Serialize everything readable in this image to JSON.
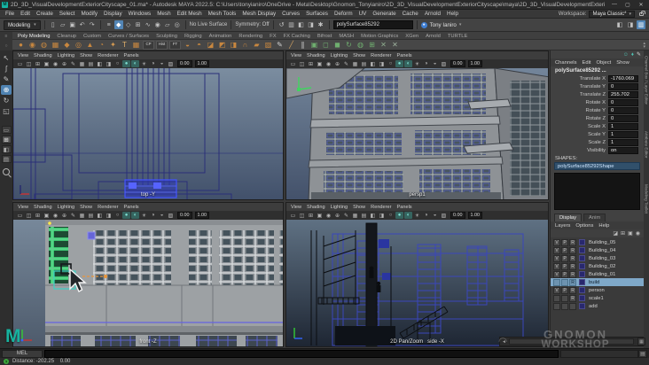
{
  "window": {
    "title": "2D_3D_VisualDevelopmentExteriorCityscape_01.ma* - Autodesk MAYA 2022.5: C:\\Users\\tonyianiro\\OneDrive - Meta\\Desktop\\Gnomon_Tonyianiro\\2D_3D_VisualDevelopmentExteriorCityscape\\maya\\2D_3D_VisualDevelopmentExteriorCityscape_01.ma --- polySurface85292...",
    "logo_letter": "M",
    "minimize": "—",
    "maximize": "▢",
    "close": "✕"
  },
  "menubar": {
    "items": [
      "File",
      "Edit",
      "Create",
      "Select",
      "Modify",
      "Display",
      "Windows",
      "Mesh",
      "Edit Mesh",
      "Mesh Tools",
      "Mesh Display",
      "Curves",
      "Surfaces",
      "Deform",
      "UV",
      "Generate",
      "Cache",
      "Arnold",
      "Help"
    ]
  },
  "workspace": {
    "label": "Workspace:",
    "value": "Maya Classic*"
  },
  "ui": {
    "dropdown_arrow": "▾",
    "scroll_left": "◄",
    "scroll_right": "►",
    "scroll_up": "▴",
    "scroll_down": "▾"
  },
  "statusline": {
    "mode": "Modeling",
    "left_icons": [
      {
        "name": "new-scene-icon",
        "glyph": "▯"
      },
      {
        "name": "open-scene-icon",
        "glyph": "▱"
      },
      {
        "name": "save-scene-icon",
        "glyph": "▣"
      },
      {
        "name": "undo-icon",
        "glyph": "↶"
      },
      {
        "name": "redo-icon",
        "glyph": "↷"
      }
    ],
    "mask_icons": [
      {
        "name": "select-by-hierarchy-icon",
        "glyph": "≡"
      },
      {
        "name": "select-by-object-icon",
        "glyph": "◆",
        "active": true
      },
      {
        "name": "select-by-component-icon",
        "glyph": "◇"
      },
      {
        "name": "snap-to-grid-icon",
        "glyph": "⊞"
      },
      {
        "name": "snap-to-curves-icon",
        "glyph": "∿"
      },
      {
        "name": "snap-to-points-icon",
        "glyph": "◉"
      },
      {
        "name": "snap-to-planes-icon",
        "glyph": "▱"
      },
      {
        "name": "make-live-icon",
        "glyph": "◎"
      }
    ],
    "no_live_surface": "No Live Surface",
    "symmetry": "Symmetry: Off",
    "object_field": "polySurface85292",
    "user": "Tony Ianiro",
    "history_icons": [
      {
        "name": "construction-history-icon",
        "glyph": "↺"
      },
      {
        "name": "open-render-view-icon",
        "glyph": "▥"
      },
      {
        "name": "render-current-frame-icon",
        "glyph": "◧"
      },
      {
        "name": "ipr-render-icon",
        "glyph": "◨"
      },
      {
        "name": "render-settings-icon",
        "glyph": "✱"
      }
    ],
    "sidebar_icons": [
      {
        "name": "show-attribute-editor-icon",
        "glyph": "◧"
      },
      {
        "name": "show-tool-settings-icon",
        "glyph": "◨"
      },
      {
        "name": "show-channel-box-icon",
        "glyph": "▥",
        "active": true
      }
    ]
  },
  "shelf": {
    "tabs": [
      {
        "label": "Poly Modeling",
        "active": true
      },
      {
        "label": "Cleanup"
      },
      {
        "label": "Custom"
      },
      {
        "label": "Curves / Surfaces"
      },
      {
        "label": "Sculpting"
      },
      {
        "label": "Rigging"
      },
      {
        "label": "Animation"
      },
      {
        "label": "Rendering"
      },
      {
        "label": "FX"
      },
      {
        "label": "FX Caching"
      },
      {
        "label": "Bifrost"
      },
      {
        "label": "MASH"
      },
      {
        "label": "Motion Graphics"
      },
      {
        "label": "XGen"
      },
      {
        "label": "Arnold"
      },
      {
        "label": "TURTLE"
      }
    ],
    "icons": [
      {
        "name": "shelf-poly-sphere-icon",
        "glyph": "●",
        "color": "#c8873f"
      },
      {
        "name": "shelf-nurbs-sphere-icon",
        "glyph": "◉",
        "color": "#c8873f"
      },
      {
        "name": "shelf-subdiv-sphere-icon",
        "glyph": "◍",
        "color": "#c8873f"
      },
      {
        "name": "shelf-poly-cube-icon",
        "glyph": "▦",
        "color": "#c8873f"
      },
      {
        "name": "shelf-platonic-solid-icon",
        "glyph": "◆",
        "color": "#c8873f"
      },
      {
        "name": "shelf-poly-torus-icon",
        "glyph": "◎",
        "color": "#c8873f"
      },
      {
        "name": "shelf-poly-cone-icon",
        "glyph": "▲",
        "color": "#c8873f"
      },
      {
        "name": "shelf-poly-helix-icon",
        "glyph": "◔",
        "color": "#c8873f"
      },
      {
        "name": "shelf-super-shape-icon",
        "glyph": "✦",
        "color": "#d79b52"
      },
      {
        "name": "shelf-text-tool-icon",
        "glyph": "T",
        "color": "#e2b06a"
      },
      {
        "name": "shelf-type-mesh-icon",
        "glyph": "▦",
        "color": "#c8873f"
      },
      {
        "name": "shelf-center-pivot-icon",
        "glyph": "CP",
        "color": "#d8d8d8",
        "mini": true
      },
      {
        "name": "shelf-delete-history-icon",
        "glyph": "Hist",
        "color": "#d8d8d8",
        "mini": true
      },
      {
        "name": "shelf-freeze-transform-icon",
        "glyph": "FT",
        "color": "#d8d8d8",
        "mini": true
      },
      {
        "name": "shelf-combine-icon",
        "glyph": "◒",
        "color": "#c8873f"
      },
      {
        "name": "shelf-separate-icon",
        "glyph": "◓",
        "color": "#c8873f"
      },
      {
        "name": "shelf-extract-icon",
        "glyph": "◪",
        "color": "#c8873f"
      },
      {
        "name": "shelf-boolean-icon",
        "glyph": "◩",
        "color": "#c8873f"
      },
      {
        "name": "shelf-mirror-icon",
        "glyph": "◨",
        "color": "#c8873f"
      },
      {
        "name": "shelf-bridge-icon",
        "glyph": "∩",
        "color": "#c8873f"
      },
      {
        "name": "shelf-fill-hole-icon",
        "glyph": "▰",
        "color": "#c8873f"
      },
      {
        "name": "shelf-extrude-icon",
        "glyph": "▧",
        "color": "#c8873f"
      },
      {
        "name": "shelf-quad-draw-icon",
        "glyph": "✎",
        "color": "#d0d0d0"
      },
      {
        "name": "shelf-multi-cut-icon",
        "glyph": "╱",
        "color": "#d0a060"
      },
      {
        "name": "shelf-insert-edge-loop-icon",
        "glyph": "∥",
        "color": "#d0d0d0"
      },
      {
        "name": "shelf-target-weld-icon",
        "glyph": "▣",
        "color": "#6fae6f"
      },
      {
        "name": "shelf-smooth-icon",
        "glyph": "◻",
        "color": "#6fae6f"
      },
      {
        "name": "shelf-crease-icon",
        "glyph": "◼",
        "color": "#6fae6f"
      },
      {
        "name": "shelf-spin-edge-icon",
        "glyph": "↻",
        "color": "#6fae6f"
      },
      {
        "name": "shelf-conform-icon",
        "glyph": "◍",
        "color": "#6fae6f"
      },
      {
        "name": "shelf-symmetrize-icon",
        "glyph": "⊞",
        "color": "#6fae6f"
      },
      {
        "name": "shelf-delete-edge-icon",
        "glyph": "✕",
        "color": "#8fae8f"
      },
      {
        "name": "shelf-collapse-edge-icon",
        "glyph": "✕",
        "color": "#9fb39f"
      }
    ]
  },
  "toolbox": {
    "tools": [
      {
        "name": "select-tool",
        "glyph": "↖"
      },
      {
        "name": "lasso-select-tool",
        "glyph": "ʃ"
      },
      {
        "name": "paint-select-tool",
        "glyph": "✎"
      },
      {
        "name": "move-tool",
        "glyph": "⊕",
        "active": true
      },
      {
        "name": "rotate-tool",
        "glyph": "↻"
      },
      {
        "name": "scale-tool",
        "glyph": "◱"
      }
    ],
    "layouts": [
      {
        "name": "single-pane-layout-button",
        "glyph": "▭"
      },
      {
        "name": "four-pane-layout-button",
        "glyph": "⊞",
        "active": true
      },
      {
        "name": "persp-outliner-layout-button",
        "glyph": "◧"
      },
      {
        "name": "outliner-layout-button",
        "glyph": "▤"
      }
    ]
  },
  "viewports": {
    "menu": [
      "View",
      "Shading",
      "Lighting",
      "Show",
      "Renderer",
      "Panels"
    ],
    "toolbar_icons": [
      {
        "name": "select-camera-icon",
        "glyph": "▭"
      },
      {
        "name": "lock-camera-icon",
        "glyph": "◫"
      },
      {
        "name": "camera-attributes-icon",
        "glyph": "⊞"
      },
      {
        "name": "bookmarks-icon",
        "glyph": "▣"
      },
      {
        "name": "image-plane-icon",
        "glyph": "◉"
      },
      {
        "name": "2d-pan-zoom-icon",
        "glyph": "⊕"
      },
      {
        "name": "grease-pencil-icon",
        "glyph": "✎"
      },
      {
        "name": "grid-icon",
        "glyph": "▦"
      },
      {
        "name": "film-gate-icon",
        "glyph": "▤"
      },
      {
        "name": "resolution-gate-icon",
        "glyph": "◧"
      },
      {
        "name": "gate-mask-icon",
        "glyph": "◨"
      },
      {
        "name": "wireframe-icon",
        "glyph": "○"
      },
      {
        "name": "shaded-icon",
        "glyph": "●",
        "active": true
      },
      {
        "name": "textured-icon",
        "glyph": "◐",
        "active": true
      },
      {
        "name": "lights-icon",
        "glyph": "☀"
      },
      {
        "name": "shadows-icon",
        "glyph": "◑"
      },
      {
        "name": "ao-icon",
        "glyph": "◒"
      },
      {
        "name": "xray-icon",
        "glyph": "▨"
      }
    ],
    "exposure": "0.00",
    "gamma": "1.00",
    "top_left": {
      "camera": "top -Y"
    },
    "top_right": {
      "camera": "persp1"
    },
    "bottom_left": {
      "camera": "front -Z"
    },
    "bottom_right": {
      "camera": "2D Pan/Zoom   side -X"
    }
  },
  "channel_box": {
    "header_icons": [
      {
        "name": "character-set-icon",
        "glyph": "☺"
      },
      {
        "name": "animation-key-icon",
        "glyph": "♦"
      },
      {
        "name": "edit-pencil-icon",
        "glyph": "✎",
        "pencil": true
      }
    ],
    "menu": [
      "Channels",
      "Edit",
      "Object",
      "Show"
    ],
    "object_name": "polySurface85292 ...",
    "channels": [
      {
        "label": "Translate X",
        "value": "-1760.069"
      },
      {
        "label": "Translate Y",
        "value": "0"
      },
      {
        "label": "Translate Z",
        "value": "255.702"
      },
      {
        "label": "Rotate X",
        "value": "0"
      },
      {
        "label": "Rotate Y",
        "value": "0"
      },
      {
        "label": "Rotate Z",
        "value": "0"
      },
      {
        "label": "Scale X",
        "value": "1"
      },
      {
        "label": "Scale Y",
        "value": "1"
      },
      {
        "label": "Scale Z",
        "value": "1"
      },
      {
        "label": "Visibility",
        "value": "on"
      }
    ],
    "shapes_label": "SHAPES:",
    "shape_name": "polySurface85292Shape"
  },
  "layer_editor": {
    "tabs": [
      {
        "label": "Display",
        "active": true
      },
      {
        "label": "Anim"
      }
    ],
    "menu": [
      "Layers",
      "Options",
      "Help"
    ],
    "toolbar_icons": [
      {
        "name": "move-objects-to-layer-icon",
        "glyph": "◪"
      },
      {
        "name": "new-layer-from-selected-icon",
        "glyph": "⊞"
      },
      {
        "name": "new-empty-layer-icon",
        "glyph": "▣"
      },
      {
        "name": "layer-options-icon",
        "glyph": "◉"
      }
    ],
    "layers": [
      {
        "v": "V",
        "p": "P",
        "r": "R",
        "name": "Building_05"
      },
      {
        "v": "V",
        "p": "P",
        "r": "R",
        "name": "Building_04"
      },
      {
        "v": "V",
        "p": "P",
        "r": "R",
        "name": "Building_03"
      },
      {
        "v": "V",
        "p": "P",
        "r": "R",
        "name": "Building_02"
      },
      {
        "v": "V",
        "p": "P",
        "r": "R",
        "name": "Building_01"
      },
      {
        "v": "",
        "p": "",
        "r": "R",
        "name": "build",
        "selected": true
      },
      {
        "v": "V",
        "p": "P",
        "r": "R",
        "name": "person"
      },
      {
        "v": "",
        "p": "",
        "r": "R",
        "name": "scale1"
      },
      {
        "v": "",
        "p": "",
        "r": "",
        "name": "add"
      }
    ]
  },
  "side_tabs": [
    {
      "label": "Channel Box / Layer Editor"
    },
    {
      "label": "Attribute Editor"
    },
    {
      "label": "Modeling Toolkit"
    }
  ],
  "command_line": {
    "label": "MEL"
  },
  "help_line": {
    "icon": "?",
    "text": "Distance: -202.25    0.00"
  },
  "watermark": {
    "line1": "GNOMON",
    "line2": "WORKSHOP",
    "swirl": "◠"
  }
}
